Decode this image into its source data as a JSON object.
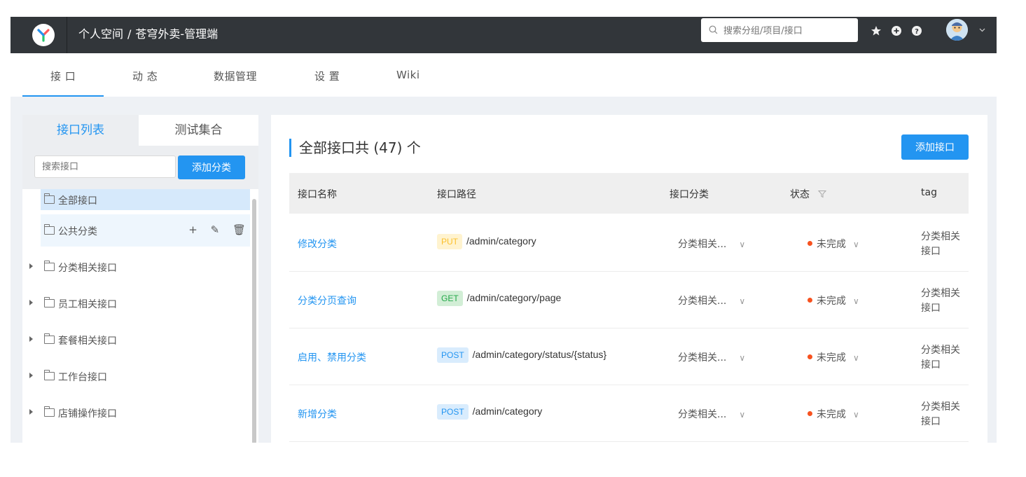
{
  "header": {
    "breadcrumb": [
      "个人空间",
      "/",
      "苍穹外卖-管理端"
    ],
    "search_placeholder": "搜索分组/项目/接口",
    "icons": [
      "star-icon",
      "plus-circle-icon",
      "help-icon",
      "avatar",
      "chevron-down-icon"
    ]
  },
  "nav": {
    "tabs": [
      "接 口",
      "动 态",
      "数据管理",
      "设 置",
      "Wiki"
    ],
    "active": 0
  },
  "left": {
    "tabs": [
      "接口列表",
      "测试集合"
    ],
    "search_placeholder": "搜索接口",
    "add_category": "添加分类",
    "tree": [
      {
        "label": "全部接口"
      },
      {
        "label": "公共分类"
      },
      {
        "label": "分类相关接口"
      },
      {
        "label": "员工相关接口"
      },
      {
        "label": "套餐相关接口"
      },
      {
        "label": "工作台接口"
      },
      {
        "label": "店铺操作接口"
      }
    ],
    "actions": {
      "add": "+",
      "edit": "✎",
      "delete": "🗑"
    }
  },
  "main": {
    "title": "全部接口共 (47) 个",
    "add_api": "添加接口",
    "columns": [
      "接口名称",
      "接口路径",
      "接口分类",
      "状态",
      "tag"
    ],
    "rows": [
      {
        "name": "修改分类",
        "method": "PUT",
        "path": "/admin/category",
        "category": "分类相关...",
        "status": "未完成",
        "tag": [
          "分类相关",
          "接口"
        ]
      },
      {
        "name": "分类分页查询",
        "method": "GET",
        "path": "/admin/category/page",
        "category": "分类相关...",
        "status": "未完成",
        "tag": [
          "分类相关",
          "接口"
        ]
      },
      {
        "name": "启用、禁用分类",
        "method": "POST",
        "path": "/admin/category/status/{status}",
        "category": "分类相关...",
        "status": "未完成",
        "tag": [
          "分类相关",
          "接口"
        ]
      },
      {
        "name": "新增分类",
        "method": "POST",
        "path": "/admin/category",
        "category": "分类相关...",
        "status": "未完成",
        "tag": [
          "分类相关",
          "接口"
        ]
      }
    ]
  },
  "colors": {
    "header_bg": "#32363a",
    "accent": "#2395f1",
    "status_dot": "#f7521f"
  }
}
